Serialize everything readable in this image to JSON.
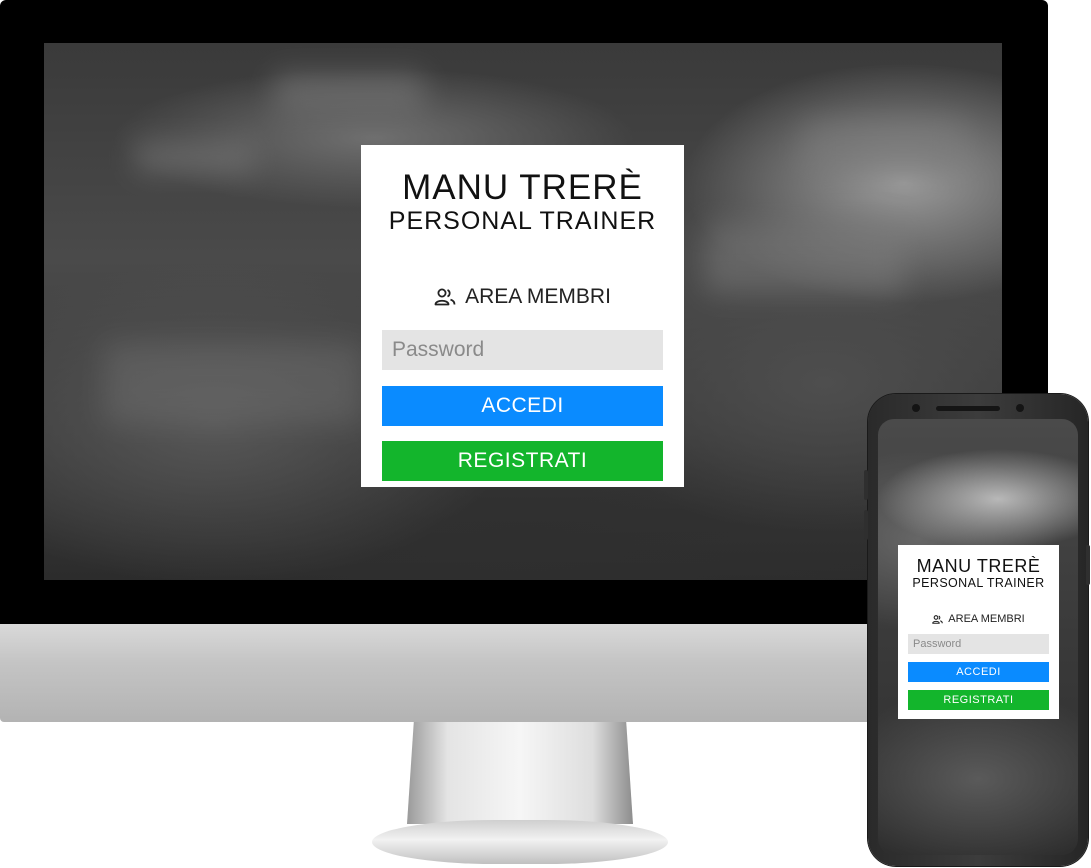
{
  "brand": {
    "name": "MANU TRERÈ",
    "subtitle": "PERSONAL TRAINER"
  },
  "login": {
    "area_label": "AREA MEMBRI",
    "area_icon": "user-group-icon",
    "password_placeholder": "Password",
    "accedi_label": "ACCEDI",
    "registrati_label": "REGISTRATI"
  },
  "colors": {
    "accedi": "#0a8bff",
    "registrati": "#13b52c",
    "field": "#e4e4e4"
  }
}
